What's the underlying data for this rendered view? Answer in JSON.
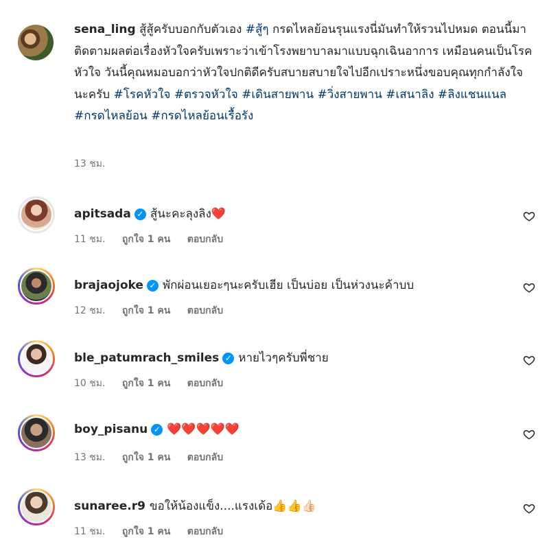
{
  "caption": {
    "username": "sena_ling",
    "text": " สู้สู้ครับบอกกับตัวเอง ",
    "tag1": "#สู้ๆ",
    "text2": " กรดไหลย้อนรุนแรงนี่มันทำให้รวนไปหมด ตอนนี้มาติดตามผลต่อเรื่องหัวใจครับเพราะว่าเข้าโรงพยาบาลมาแบบฉุกเฉินอาการ เหมือนคนเป็นโรคหัวใจ วันนี้คุณหมอบอกว่าหัวใจปกติดีครับสบายสบายใจไปอีกเปราะหนึ่งขอบคุณทุกกำลังใจนะครับ ",
    "tags": "#โรคหัวใจ #ตรวจหัวใจ #เดินสายพาน #วิ่งสายพาน #เสนาลิง #ลิงแชนแนล #กรดไหลย้อน #กรดไหลย้อนเรื้อรัง",
    "time": "13 ชม."
  },
  "comments": [
    {
      "username": "apitsada",
      "verified": true,
      "text": "สู้นะคะลุงลิง❤️",
      "time": "11 ชม.",
      "likes": "ถูกใจ 1 คน",
      "reply": "ตอบกลับ"
    },
    {
      "username": "brajaojoke",
      "verified": true,
      "text": "พักผ่อนเยอะๆนะครับเฮีย เป็นบ่อย เป็นห่วงนะค้าบบ",
      "time": "12 ชม.",
      "likes": "ถูกใจ 1 คน",
      "reply": "ตอบกลับ"
    },
    {
      "username": "ble_patumrach_smiles",
      "verified": true,
      "text": "หายไวๆครับพี่ชาย",
      "time": "10 ชม.",
      "likes": "ถูกใจ 1 คน",
      "reply": "ตอบกลับ"
    },
    {
      "username": "boy_pisanu",
      "verified": true,
      "text": "❤️❤️❤️❤️❤️",
      "time": "13 ชม.",
      "likes": "ถูกใจ 1 คน",
      "reply": "ตอบกลับ"
    },
    {
      "username": "sunaree.r9",
      "verified": false,
      "text": "ขอให้น้องแข็ง....แรงเด้อ👍👍👍🏻",
      "time": "11 ชม.",
      "likes": "ถูกใจ 1 คน",
      "reply": "ตอบกลับ"
    }
  ],
  "colors": {
    "verified": "#0095f6",
    "hashtag": "#00376b",
    "meta": "#737373"
  }
}
